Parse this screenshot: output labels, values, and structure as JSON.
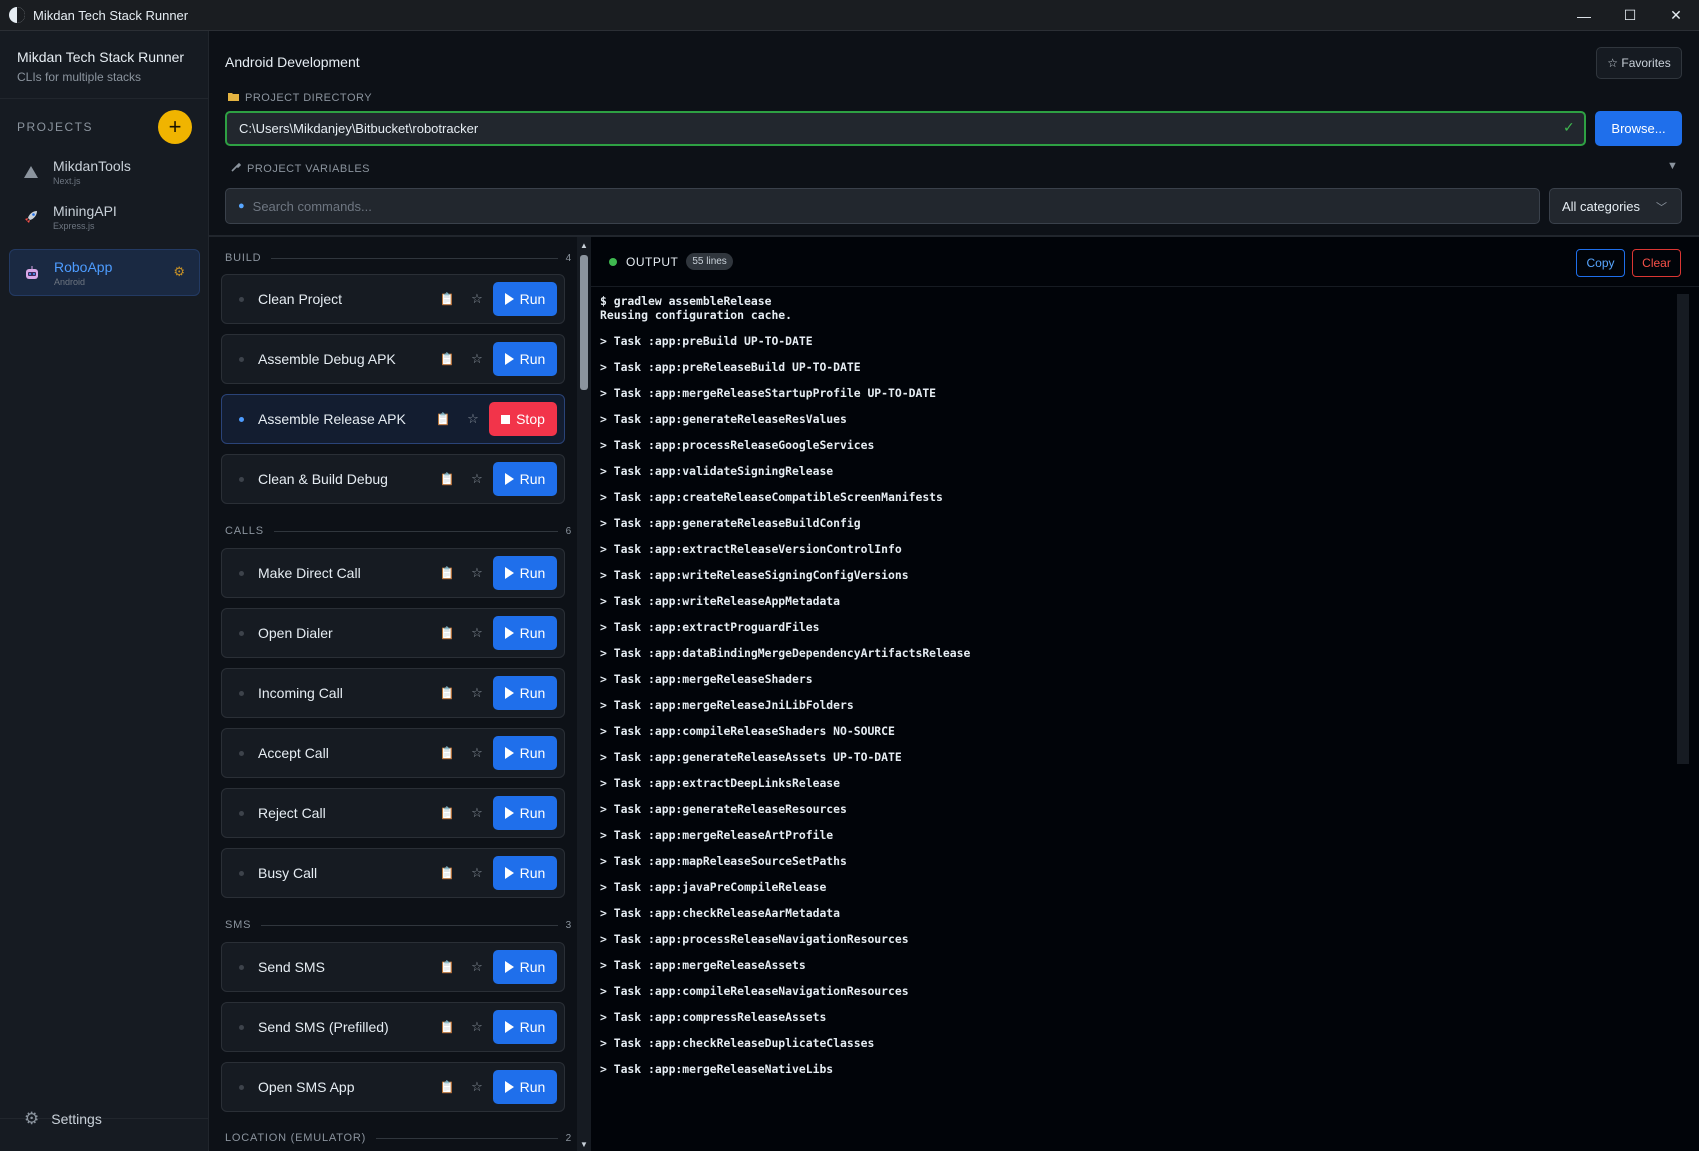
{
  "window": {
    "title": "Mikdan Tech Stack Runner",
    "minimize": "—",
    "maximize": "☐",
    "close": "✕"
  },
  "sidebar": {
    "brand_title": "Mikdan Tech Stack Runner",
    "brand_subtitle": "CLIs for multiple stacks",
    "projects_label": "PROJECTS",
    "add_label": "+",
    "projects": [
      {
        "name": "MikdanTools",
        "type": "Next.js",
        "icon": "triangle-icon"
      },
      {
        "name": "MiningAPI",
        "type": "Express.js",
        "icon": "rocket-icon"
      },
      {
        "name": "RoboApp",
        "type": "Android",
        "icon": "robot-icon"
      }
    ],
    "settings_label": "Settings"
  },
  "header": {
    "context_title": "Android Development",
    "favorites_label": "☆ Favorites",
    "project_directory_label": "PROJECT DIRECTORY",
    "project_directory_value": "C:\\Users\\Mikdanjey\\Bitbucket\\robotracker",
    "browse_label": "Browse...",
    "project_variables_label": "PROJECT VARIABLES",
    "search_placeholder": "Search commands...",
    "category_selected": "All categories"
  },
  "groups": [
    {
      "label": "BUILD",
      "count": "4",
      "commands": [
        {
          "name": "Clean Project",
          "action": "Run"
        },
        {
          "name": "Assemble Debug APK",
          "action": "Run"
        },
        {
          "name": "Assemble Release APK",
          "action": "Stop"
        },
        {
          "name": "Clean & Build Debug",
          "action": "Run"
        }
      ]
    },
    {
      "label": "CALLS",
      "count": "6",
      "commands": [
        {
          "name": "Make Direct Call",
          "action": "Run"
        },
        {
          "name": "Open Dialer",
          "action": "Run"
        },
        {
          "name": "Incoming Call",
          "action": "Run"
        },
        {
          "name": "Accept Call",
          "action": "Run"
        },
        {
          "name": "Reject Call",
          "action": "Run"
        },
        {
          "name": "Busy Call",
          "action": "Run"
        }
      ]
    },
    {
      "label": "SMS",
      "count": "3",
      "commands": [
        {
          "name": "Send SMS",
          "action": "Run"
        },
        {
          "name": "Send SMS (Prefilled)",
          "action": "Run"
        },
        {
          "name": "Open SMS App",
          "action": "Run"
        }
      ]
    },
    {
      "label": "LOCATION (EMULATOR)",
      "count": "2",
      "commands": []
    }
  ],
  "output": {
    "title": "OUTPUT",
    "lines_badge": "55 lines",
    "copy_label": "Copy",
    "clear_label": "Clear",
    "lines": [
      "$ gradlew assembleRelease",
      "Reusing configuration cache.",
      "",
      "> Task :app:preBuild UP-TO-DATE",
      "",
      "> Task :app:preReleaseBuild UP-TO-DATE",
      "",
      "> Task :app:mergeReleaseStartupProfile UP-TO-DATE",
      "",
      "> Task :app:generateReleaseResValues",
      "",
      "> Task :app:processReleaseGoogleServices",
      "",
      "> Task :app:validateSigningRelease",
      "",
      "> Task :app:createReleaseCompatibleScreenManifests",
      "",
      "> Task :app:generateReleaseBuildConfig",
      "",
      "> Task :app:extractReleaseVersionControlInfo",
      "",
      "> Task :app:writeReleaseSigningConfigVersions",
      "",
      "> Task :app:writeReleaseAppMetadata",
      "",
      "> Task :app:extractProguardFiles",
      "",
      "> Task :app:dataBindingMergeDependencyArtifactsRelease",
      "",
      "> Task :app:mergeReleaseShaders",
      "",
      "> Task :app:mergeReleaseJniLibFolders",
      "",
      "> Task :app:compileReleaseShaders NO-SOURCE",
      "",
      "> Task :app:generateReleaseAssets UP-TO-DATE",
      "",
      "> Task :app:extractDeepLinksRelease",
      "",
      "> Task :app:generateReleaseResources",
      "",
      "> Task :app:mergeReleaseArtProfile",
      "",
      "> Task :app:mapReleaseSourceSetPaths",
      "",
      "> Task :app:javaPreCompileRelease",
      "",
      "> Task :app:checkReleaseAarMetadata",
      "",
      "> Task :app:processReleaseNavigationResources",
      "",
      "> Task :app:mergeReleaseAssets",
      "",
      "> Task :app:compileReleaseNavigationResources",
      "",
      "> Task :app:compressReleaseAssets",
      "",
      "> Task :app:checkReleaseDuplicateClasses",
      "",
      "> Task :app:mergeReleaseNativeLibs"
    ]
  }
}
